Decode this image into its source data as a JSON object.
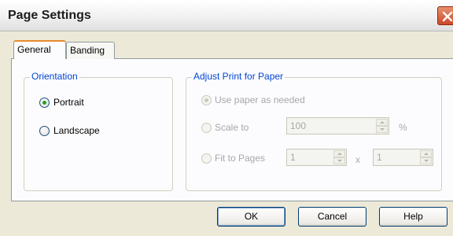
{
  "window": {
    "title": "Page Settings",
    "close_icon": "close-icon"
  },
  "tabs": [
    {
      "label": "General",
      "selected": true
    },
    {
      "label": "Banding",
      "selected": false
    }
  ],
  "orientation": {
    "legend": "Orientation",
    "options": [
      {
        "label": "Portrait",
        "checked": true
      },
      {
        "label": "Landscape",
        "checked": false
      }
    ]
  },
  "adjust": {
    "legend": "Adjust Print for Paper",
    "use_paper_label": "Use paper as needed",
    "scale_label": "Scale to",
    "scale_value": "100",
    "scale_unit": "%",
    "fit_label": "Fit to Pages",
    "fit_wide": "1",
    "fit_x": "x",
    "fit_tall": "1"
  },
  "buttons": {
    "ok": "OK",
    "cancel": "Cancel",
    "help": "Help"
  },
  "colors": {
    "accent": "#0046d5",
    "tab_highlight": "#e68b2c",
    "close": "#c94a2a"
  }
}
